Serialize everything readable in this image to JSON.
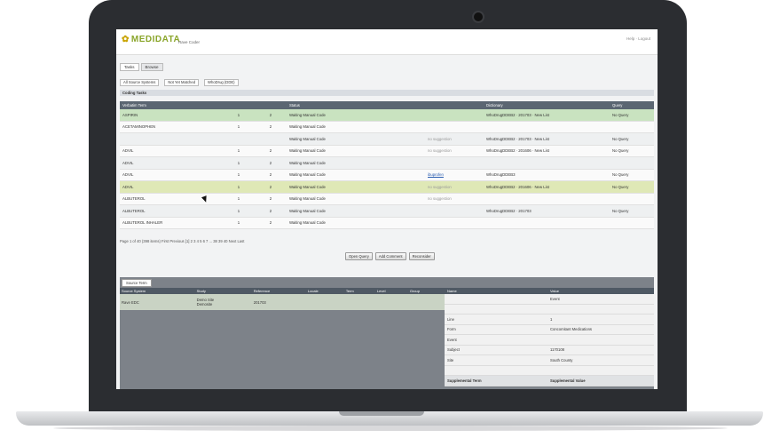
{
  "app": {
    "logo": "MEDIDATA",
    "logo_mark": "✿",
    "menu": "Rave Coder",
    "user_links": "Help · Logout"
  },
  "tabs": [
    {
      "label": "Tasks",
      "active": true
    },
    {
      "label": "Browse",
      "active": false
    }
  ],
  "filters": {
    "source_system": "All Source Systems",
    "status": "Not Yet Matched",
    "type": "WhoDrug (DDE)"
  },
  "panel_title": "Coding Tasks",
  "grid": {
    "columns": [
      "Verbatim Term",
      "",
      "",
      "Status",
      "",
      "Dictionary",
      "",
      "Query"
    ],
    "rows": [
      {
        "term": "ASPIRIN",
        "c1": "1",
        "c2": "2",
        "status": "Waiting Manual Code",
        "suggest": "",
        "dict": "WhoDrugDDEB2 · 201703 · New List",
        "query": "No Query",
        "style": "sel"
      },
      {
        "term": "ACETAMINOPHEN",
        "c1": "1",
        "c2": "2",
        "status": "Waiting Manual Code",
        "suggest": "",
        "dict": "",
        "query": "",
        "style": "odd"
      },
      {
        "term": "",
        "c1": "",
        "c2": "",
        "status": "Waiting Manual Code",
        "suggest": "no suggestion",
        "dict": "WhoDrugDDEB2 · 201703 · New List",
        "query": "No Query",
        "style": "even"
      },
      {
        "term": "ADVIL",
        "c1": "1",
        "c2": "2",
        "status": "Waiting Manual Code",
        "suggest": "no suggestion",
        "dict": "WhoDrugDDEB2 · 201606 · New List",
        "query": "No Query",
        "style": "odd"
      },
      {
        "term": "ADVIL",
        "c1": "1",
        "c2": "2",
        "status": "Waiting Manual Code",
        "suggest": "",
        "dict": "",
        "query": "",
        "style": "even"
      },
      {
        "term": "ADVIL",
        "c1": "1",
        "c2": "2",
        "status": "Waiting Manual Code",
        "suggest": "ibuprofen",
        "dict": "WhoDrugDDEB3",
        "query": "No Query",
        "style": "odd"
      },
      {
        "term": "ADVIL",
        "c1": "1",
        "c2": "2",
        "status": "Waiting Manual Code",
        "suggest": "no suggestion",
        "dict": "WhoDrugDDEB2 · 201606 · New List",
        "query": "No Query",
        "style": "hl"
      },
      {
        "term": "ALBUTEROL",
        "c1": "1",
        "c2": "2",
        "status": "Waiting Manual Code",
        "suggest": "no suggestion",
        "dict": "",
        "query": "",
        "style": "odd"
      },
      {
        "term": "ALBUTEROL",
        "c1": "1",
        "c2": "2",
        "status": "Waiting Manual Code",
        "suggest": "",
        "dict": "WhoDrugDDEB2 · 201703",
        "query": "No Query",
        "style": "even"
      },
      {
        "term": "ALBUTEROL INHALER",
        "c1": "1",
        "c2": "2",
        "status": "Waiting Manual Code",
        "suggest": "",
        "dict": "",
        "query": "",
        "style": "odd"
      }
    ]
  },
  "pager": "Page 1 of 40 (398 items)   First  Previous  [1] 2 3 4 5 6 7 ... 38 39 40  Next  Last",
  "buttons": [
    "Open Query",
    "Add Comment",
    "Reconsider"
  ],
  "source_tab": "Source Term",
  "source_grid": {
    "columns": [
      "Source System",
      "Study",
      "Reference",
      "Locale",
      "Term",
      "Level",
      "Group"
    ],
    "row": [
      "Rave EDC",
      "Demo Site",
      "201703",
      "",
      "",
      "",
      ""
    ],
    "row2": [
      "",
      "Demosite",
      "",
      "",
      "",
      "",
      ""
    ]
  },
  "props": {
    "columns": [
      "Name",
      "Value"
    ],
    "rows": [
      {
        "name": "",
        "value": "Event"
      },
      {
        "name": "",
        "value": ""
      },
      {
        "name": "Line",
        "value": "1"
      },
      {
        "name": "Form",
        "value": "Concomitant Medications"
      },
      {
        "name": "Event",
        "value": ""
      },
      {
        "name": "Subject",
        "value": "1170108"
      },
      {
        "name": "Site",
        "value": "South County"
      },
      {
        "name": "",
        "value": ""
      },
      {
        "name": "Supplemental Term",
        "value": "Supplemental Value",
        "style": "sp"
      }
    ]
  }
}
